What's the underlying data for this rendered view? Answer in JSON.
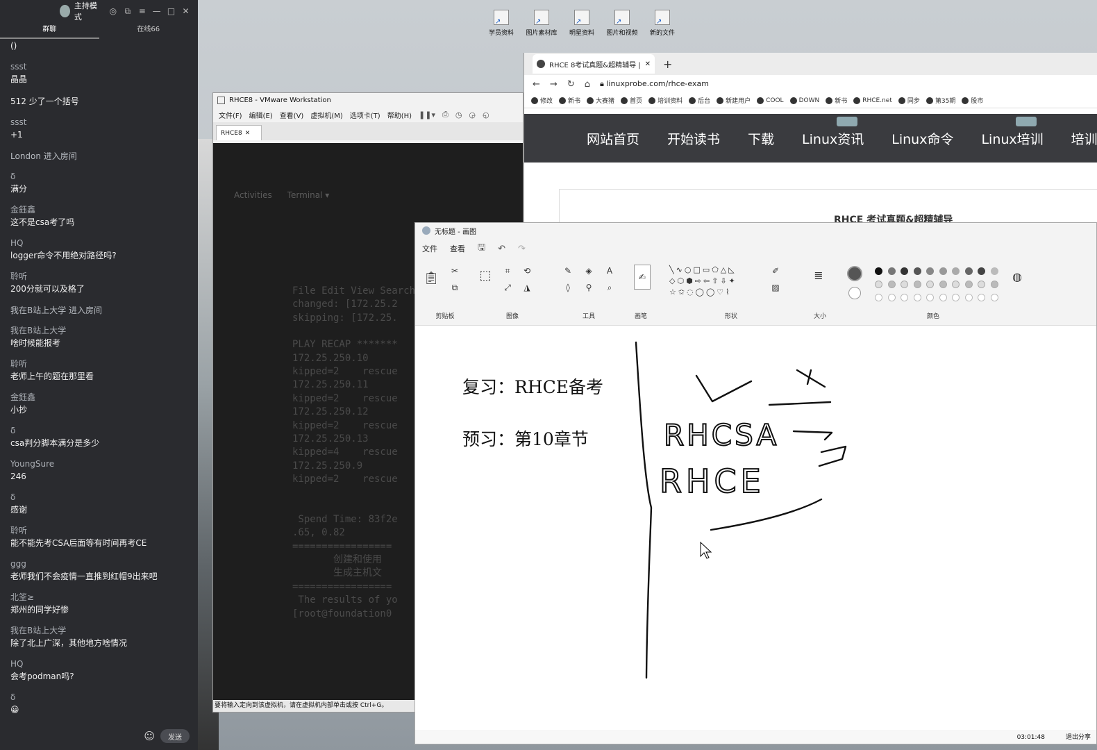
{
  "chat": {
    "mode": "主持模式",
    "tabs": [
      "群聊",
      "在线66"
    ],
    "messages": [
      {
        "user": "",
        "text": "()"
      },
      {
        "user": "ssst",
        "text": "晶晶"
      },
      {
        "user": "",
        "text": "512 少了一个括号"
      },
      {
        "user": "ssst",
        "text": "+1"
      },
      {
        "system": "London 进入房间"
      },
      {
        "user": "δ",
        "text": "满分"
      },
      {
        "user": "金鈺鑫",
        "text": "这不是csa考了吗"
      },
      {
        "user": "HQ",
        "text": "logger命令不用绝对路径吗?"
      },
      {
        "user": "聆听",
        "text": "200分就可以及格了"
      },
      {
        "system": "我在B站上大学 进入房间"
      },
      {
        "user": "我在B站上大学",
        "text": "啥时候能报考"
      },
      {
        "user": "聆听",
        "text": "老师上午的题在那里看"
      },
      {
        "user": "金鈺鑫",
        "text": "小抄"
      },
      {
        "user": "δ",
        "text": "csa判分脚本满分是多少"
      },
      {
        "user": "YoungSure",
        "text": "246"
      },
      {
        "user": "δ",
        "text": "感谢"
      },
      {
        "user": "聆听",
        "text": "能不能先考CSA后面等有时间再考CE"
      },
      {
        "user": "ggg",
        "text": "老师我们不会疫情一直推到红帽9出来吧"
      },
      {
        "user": "北筌≥",
        "text": "郑州的同学好惨"
      },
      {
        "user": "我在B站上大学",
        "text": "除了北上广深，其他地方啥情况"
      },
      {
        "user": "HQ",
        "text": "会考podman吗?"
      },
      {
        "user": "δ",
        "text": "😀"
      }
    ],
    "send_label": "发送"
  },
  "desktop": {
    "icons": [
      "学员资料",
      "图片素材库",
      "明星资料",
      "图片和视频",
      "新的文件"
    ]
  },
  "vmware": {
    "title": "RHCE8 - VMware Workstation",
    "menus": [
      "文件(F)",
      "编辑(E)",
      "查看(V)",
      "虚拟机(M)",
      "选项卡(T)",
      "帮助(H)"
    ],
    "tab": "RHCE8",
    "gnome": {
      "activities": "Activities",
      "terminal": "Terminal ▾"
    },
    "terminal_lines": [
      "File Edit View Search T",
      "changed: [172.25.2",
      "skipping: [172.25.",
      "",
      "PLAY RECAP *******",
      "172.25.250.10",
      "kipped=2    rescue",
      "172.25.250.11",
      "kipped=2    rescue",
      "172.25.250.12",
      "kipped=2    rescue",
      "172.25.250.13",
      "kipped=4    rescue",
      "172.25.250.9",
      "kipped=2    rescue",
      "",
      "",
      " Spend Time: 83f2e",
      ".65, 0.82",
      "=================",
      "       创建和使用",
      "       生成主机文",
      "=================",
      " The results of yo",
      "[root@foundation0"
    ],
    "status": "要将输入定向到该虚拟机，请在虚拟机内部单击或按 Ctrl+G。"
  },
  "browser": {
    "tab_title": "RHCE 8考试真题&超精辅导 | ",
    "url": "linuxprobe.com/rhce-exam",
    "bookmarks": [
      "修改",
      "新书",
      "大赛猪",
      "首页",
      "培训资料",
      "后台",
      "新建用户",
      "COOL",
      "DOWN",
      "新书",
      "RHCE.net",
      "同步",
      "第35期",
      "股市"
    ],
    "nav": [
      "网站首页",
      "开始读书",
      "下载",
      "Linux资讯",
      "Linux命令",
      "Linux培训",
      "培训"
    ],
    "heading": "RHCE 考试真题&超精辅导"
  },
  "paint": {
    "title": "无标题 - 画图",
    "menus": [
      "文件",
      "查看"
    ],
    "groups": [
      "剪贴板",
      "图像",
      "工具",
      "画笔",
      "形状",
      "大小",
      "颜色"
    ],
    "note1": "复习：RHCE备考",
    "note2": "预习：第10章节",
    "handwriting": [
      "RHCSA",
      "RHCE"
    ],
    "time": "03:01:48",
    "share": "退出分享",
    "ink_color": "#111111"
  }
}
